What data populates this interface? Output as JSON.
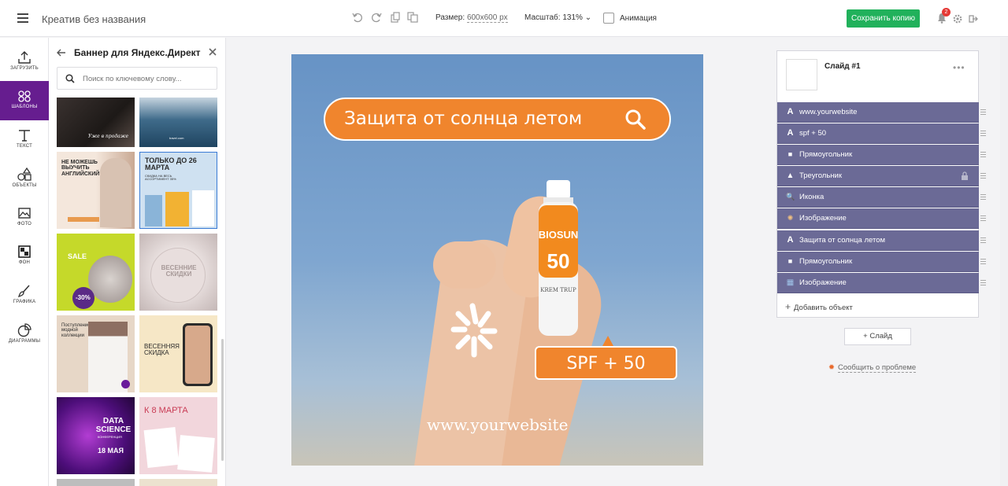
{
  "topbar": {
    "doc_title": "Креатив без названия",
    "size_label": "Размер:",
    "size_value": "600x600 px",
    "zoom_label": "Масштаб: 131%",
    "animation_label": "Анимация",
    "save_button": "Сохранить копию",
    "notification_count": "2"
  },
  "nav": {
    "items": [
      {
        "label": "ЗАГРУЗИТЬ",
        "icon": "upload-icon"
      },
      {
        "label": "ШАБЛОНЫ",
        "icon": "templates-icon",
        "active": true
      },
      {
        "label": "ТЕКСТ",
        "icon": "text-icon"
      },
      {
        "label": "ОБЪЕКТЫ",
        "icon": "shapes-icon"
      },
      {
        "label": "ФОТО",
        "icon": "photo-icon"
      },
      {
        "label": "ФОН",
        "icon": "background-icon"
      },
      {
        "label": "ГРАФИКА",
        "icon": "brush-icon"
      },
      {
        "label": "ДИАГРАММЫ",
        "icon": "pie-chart-icon"
      }
    ]
  },
  "templates_panel": {
    "title": "Баннер для Яндекс.Директ",
    "search_placeholder": "Поиск по ключевому слову...",
    "cards": {
      "c1_text": "Уже в продаже",
      "c2_text": "travel.com",
      "c3_title": "НЕ МОЖЕШЬ ВЫУЧИТЬ АНГЛИЙСКИЙ?",
      "c4_title": "ТОЛЬКО ДО 26 МАРТА",
      "c4_sub": "СКИДКА НА ВЕСЬ АССОРТИМЕНТ 35%",
      "c5_title": "SALE",
      "c5_badge": "-30%",
      "c6_title": "ВЕСЕННИЕ СКИДКИ",
      "c7_title": "Поступление модной коллекции",
      "c8_title": "ВЕСЕННЯЯ СКИДКА",
      "c9_title": "DATA SCIENCE",
      "c9_sub": "КОНФЕРЕНЦИЯ",
      "c9_date": "18 МАЯ",
      "c10_title": "К 8 МАРТА"
    }
  },
  "canvas": {
    "headline": "Защита от солнца летом",
    "spf": "SPF + 50",
    "bottle_brand": "BIOSUN",
    "bottle_number": "50",
    "bottle_sub": "KREM TRUP",
    "website": "www.yourwebsite"
  },
  "layers_panel": {
    "slide_name": "Слайд #1",
    "more": "•••",
    "rows": [
      {
        "label": "www.yourwebsite",
        "icon": "A"
      },
      {
        "label": "spf + 50",
        "icon": "A"
      },
      {
        "label": "Прямоугольник",
        "icon": "■"
      },
      {
        "label": "Треугольник",
        "icon": "▲"
      },
      {
        "label": "Иконка",
        "icon": "🔍"
      },
      {
        "label": "Изображение",
        "icon": "✺"
      },
      {
        "label": "Защита от солнца летом",
        "icon": "A"
      },
      {
        "label": "Прямоугольник",
        "icon": "■"
      },
      {
        "label": "Изображение",
        "icon": "▦"
      }
    ],
    "add_object": "Добавить объект"
  },
  "slide_button": "Слайд",
  "report_link": "Сообщить о проблеме",
  "colors": {
    "accent_purple": "#661d8f",
    "layer_row": "#6b6a96",
    "save_green": "#21b15b",
    "orange": "#f0852d"
  }
}
